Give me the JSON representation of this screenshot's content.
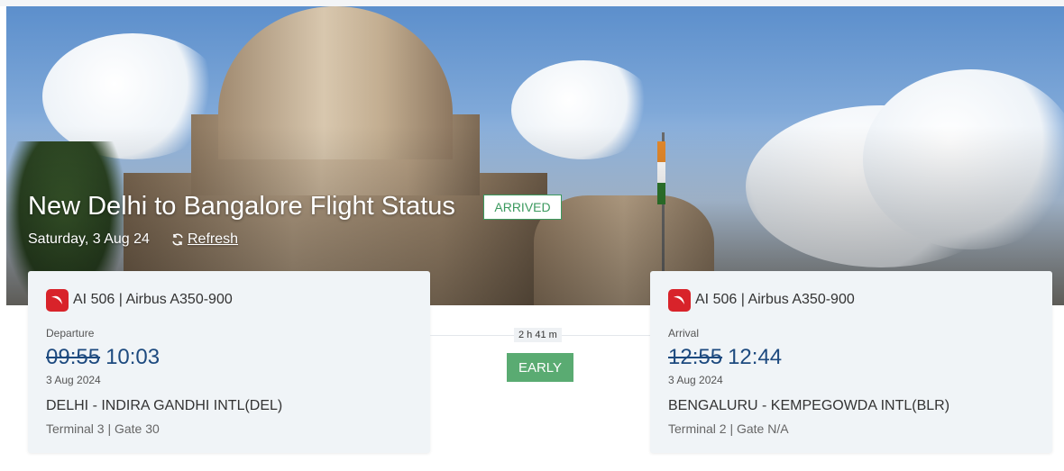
{
  "header": {
    "title": "New Delhi to Bangalore Flight Status",
    "status": "ARRIVED",
    "date": "Saturday, 3 Aug 24",
    "refresh_label": "Refresh"
  },
  "departure": {
    "flight_number": "AI 506",
    "aircraft": "| Airbus A350-900",
    "label": "Departure",
    "scheduled_time": "09:55",
    "actual_time": "10:03",
    "date": "3 Aug 2024",
    "airport": "DELHI - INDIRA GANDHI INTL(DEL)",
    "terminal_gate": "Terminal 3 | Gate 30"
  },
  "arrival": {
    "flight_number": "AI 506",
    "aircraft": "| Airbus A350-900",
    "label": "Arrival",
    "scheduled_time": "12:55",
    "actual_time": "12:44",
    "date": "3 Aug 2024",
    "airport": "BENGALURU - KEMPEGOWDA INTL(BLR)",
    "terminal_gate": "Terminal 2 | Gate N/A"
  },
  "journey": {
    "duration": "2 h 41 m",
    "timing_status": "EARLY"
  },
  "icons": {
    "refresh": "refresh-icon",
    "airline": "air-india-logo"
  },
  "colors": {
    "status_green": "#3c9a5f",
    "early_green": "#5aab72",
    "time_blue": "#1d4a7f",
    "airline_red": "#d8232a"
  }
}
